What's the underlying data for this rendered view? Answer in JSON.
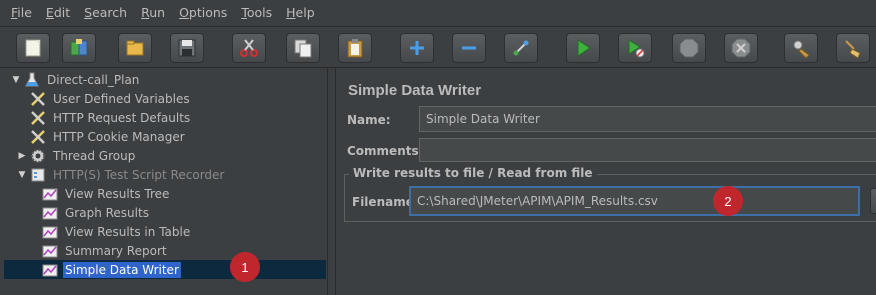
{
  "menu": [
    "File",
    "Edit",
    "Search",
    "Run",
    "Options",
    "Tools",
    "Help"
  ],
  "toolbar": {
    "buttons": [
      "new",
      "templates",
      "open",
      "save",
      "cut",
      "copy",
      "paste",
      "expand",
      "collapse",
      "toggle",
      "start",
      "start-no-timers",
      "stop",
      "shutdown",
      "clear",
      "clear-all"
    ]
  },
  "tree": {
    "items": [
      {
        "label": "Direct-call_Plan",
        "icon": "test-plan-icon"
      },
      {
        "label": "User Defined Variables",
        "icon": "wrench-icon"
      },
      {
        "label": "HTTP Request Defaults",
        "icon": "wrench-icon"
      },
      {
        "label": "HTTP Cookie Manager",
        "icon": "wrench-icon"
      },
      {
        "label": "Thread Group",
        "icon": "gear-icon"
      },
      {
        "label": "HTTP(S) Test Script Recorder",
        "icon": "recorder-icon"
      },
      {
        "label": "View Results Tree",
        "icon": "listener-icon"
      },
      {
        "label": "Graph Results",
        "icon": "listener-icon"
      },
      {
        "label": "View Results in Table",
        "icon": "listener-icon"
      },
      {
        "label": "Summary Report",
        "icon": "listener-icon"
      },
      {
        "label": "Simple Data Writer",
        "icon": "listener-icon"
      }
    ]
  },
  "badges": [
    "1",
    "2"
  ],
  "panel": {
    "title": "Simple Data Writer",
    "name_label": "Name:",
    "name_value": "Simple Data Writer",
    "comments_label": "Comments:",
    "comments_value": "",
    "group_title": "Write results to file / Read from file",
    "filename_label": "Filename",
    "filename_value": "C:\\Shared\\JMeter\\APIM\\APIM_Results.csv"
  },
  "colors": {
    "background": "#3c3f41",
    "selection": "#2f65ca",
    "badge": "#c0272d",
    "focus_border": "#3d6ea8"
  }
}
